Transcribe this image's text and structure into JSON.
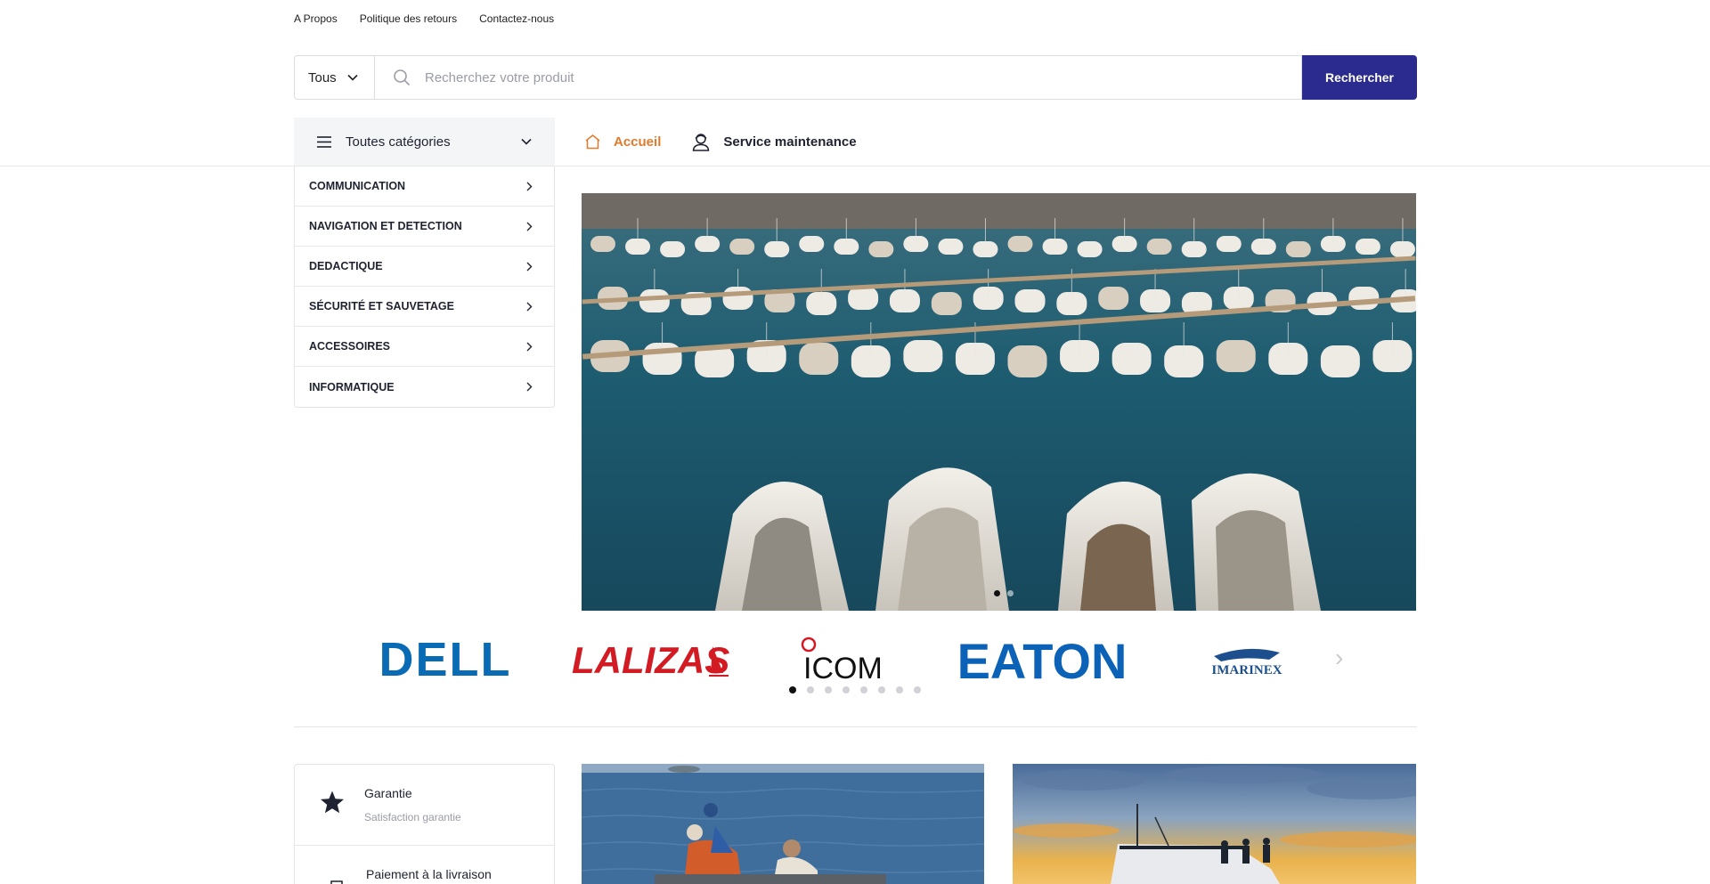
{
  "toplinks": [
    "A Propos",
    "Politique des retours",
    "Contactez-nous"
  ],
  "search": {
    "scope": "Tous",
    "placeholder": "Recherchez votre produit",
    "button": "Rechercher"
  },
  "categories_button": "Toutes catégories",
  "nav": {
    "home": "Accueil",
    "maintenance": "Service maintenance"
  },
  "categories": [
    "COMMUNICATION",
    "NAVIGATION ET DETECTION",
    "DEDACTIQUE",
    "SÉCURITÉ ET SAUVETAGE",
    "ACCESSOIRES",
    "INFORMATIQUE"
  ],
  "hero_slide_count": 2,
  "hero_active_slide": 1,
  "brands": {
    "dell": "DELL",
    "lalizas": "LALIZAS",
    "icom": "ICOM",
    "eaton": "EATON",
    "imarinex": "IMARINEX"
  },
  "brand_pages": 8,
  "brand_active_page": 1,
  "features": [
    {
      "title": "Garantie",
      "subtitle": "Satisfaction garantie",
      "icon": "star-icon"
    },
    {
      "title": "Paiement à la livraison",
      "subtitle": "",
      "icon": "delivery-payment-icon"
    }
  ],
  "colors": {
    "primary": "#2b2a8e",
    "accent": "#e07a2c",
    "dell": "#0a6bb5",
    "lalizas": "#d31b24",
    "eaton": "#0c62b6",
    "imarinex": "#1d4f8f"
  }
}
